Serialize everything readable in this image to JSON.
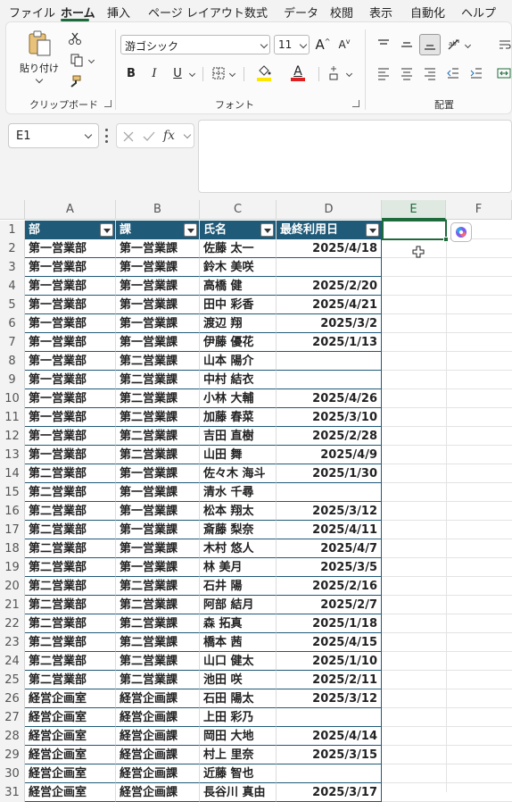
{
  "menu": [
    "ファイル",
    "ホーム",
    "挿入",
    "ページ レイアウト",
    "数式",
    "データ",
    "校閲",
    "表示",
    "自動化",
    "ヘルプ"
  ],
  "ribbon": {
    "paste_label": "貼り付け",
    "font_name": "游ゴシック",
    "font_size": "11",
    "group_clipboard": "クリップボード",
    "group_font": "フォント",
    "group_align": "配置",
    "bold": "B",
    "italic": "I",
    "underline": "U",
    "grow": "A",
    "shrink": "A",
    "font_color_letter": "A",
    "accent_highlight": "#ffe600",
    "accent_font": "#e02020"
  },
  "formula_bar": {
    "namebox": "E1",
    "fx": "fx",
    "value": ""
  },
  "grid": {
    "columns": [
      "A",
      "B",
      "C",
      "D",
      "E",
      "F"
    ],
    "selected_column": "E",
    "header": [
      "部",
      "課",
      "氏名",
      "最終利用日"
    ],
    "rows": [
      [
        "第一営業部",
        "第一営業課",
        "佐藤 太一",
        "2025/4/18"
      ],
      [
        "第一営業部",
        "第一営業課",
        "鈴木 美咲",
        ""
      ],
      [
        "第一営業部",
        "第一営業課",
        "高橋 健",
        "2025/2/20"
      ],
      [
        "第一営業部",
        "第一営業課",
        "田中 彩香",
        "2025/4/21"
      ],
      [
        "第一営業部",
        "第一営業課",
        "渡辺 翔",
        "2025/3/2"
      ],
      [
        "第一営業部",
        "第一営業課",
        "伊藤 優花",
        "2025/1/13"
      ],
      [
        "第一営業部",
        "第二営業課",
        "山本 陽介",
        ""
      ],
      [
        "第一営業部",
        "第二営業課",
        "中村 結衣",
        ""
      ],
      [
        "第一営業部",
        "第二営業課",
        "小林 大輔",
        "2025/4/26"
      ],
      [
        "第一営業部",
        "第二営業課",
        "加藤 春菜",
        "2025/3/10"
      ],
      [
        "第一営業部",
        "第二営業課",
        "吉田 直樹",
        "2025/2/28"
      ],
      [
        "第一営業部",
        "第二営業課",
        "山田 舞",
        "2025/4/9"
      ],
      [
        "第二営業部",
        "第一営業課",
        "佐々木 海斗",
        "2025/1/30"
      ],
      [
        "第二営業部",
        "第一営業課",
        "清水 千尋",
        ""
      ],
      [
        "第二営業部",
        "第一営業課",
        "松本 翔太",
        "2025/3/12"
      ],
      [
        "第二営業部",
        "第一営業課",
        "斎藤 梨奈",
        "2025/4/11"
      ],
      [
        "第二営業部",
        "第一営業課",
        "木村 悠人",
        "2025/4/7"
      ],
      [
        "第二営業部",
        "第一営業課",
        "林 美月",
        "2025/3/5"
      ],
      [
        "第二営業部",
        "第二営業課",
        "石井 陽",
        "2025/2/16"
      ],
      [
        "第二営業部",
        "第二営業課",
        "阿部 結月",
        "2025/2/7"
      ],
      [
        "第二営業部",
        "第二営業課",
        "森 拓真",
        "2025/1/18"
      ],
      [
        "第二営業部",
        "第二営業課",
        "橋本 茜",
        "2025/4/15"
      ],
      [
        "第二営業部",
        "第二営業課",
        "山口 健太",
        "2025/1/10"
      ],
      [
        "第二営業部",
        "第二営業課",
        "池田 咲",
        "2025/2/11"
      ],
      [
        "経営企画室",
        "経営企画課",
        "石田 陽太",
        "2025/3/12"
      ],
      [
        "経営企画室",
        "経営企画課",
        "上田 彩乃",
        ""
      ],
      [
        "経営企画室",
        "経営企画課",
        "岡田 大地",
        "2025/4/14"
      ],
      [
        "経営企画室",
        "経営企画課",
        "村上 里奈",
        "2025/3/15"
      ],
      [
        "経営企画室",
        "経営企画課",
        "近藤 智也",
        ""
      ],
      [
        "経営企画室",
        "経営企画課",
        "長谷川 真由",
        "2025/3/17"
      ]
    ]
  }
}
